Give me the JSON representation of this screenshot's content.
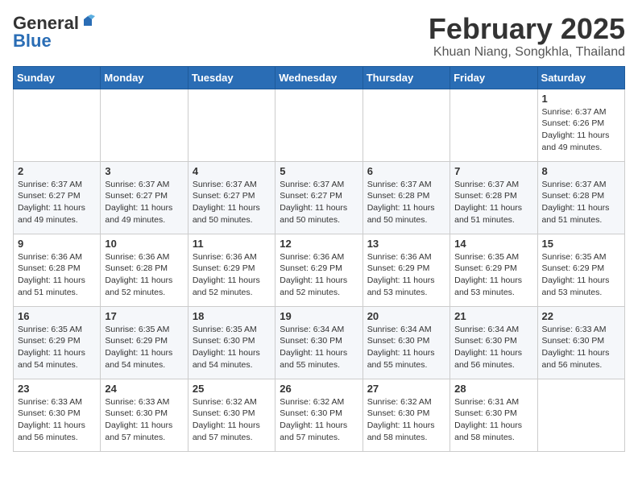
{
  "header": {
    "logo_general": "General",
    "logo_blue": "Blue",
    "month_title": "February 2025",
    "location": "Khuan Niang, Songkhla, Thailand"
  },
  "weekdays": [
    "Sunday",
    "Monday",
    "Tuesday",
    "Wednesday",
    "Thursday",
    "Friday",
    "Saturday"
  ],
  "weeks": [
    [
      {
        "day": "",
        "info": ""
      },
      {
        "day": "",
        "info": ""
      },
      {
        "day": "",
        "info": ""
      },
      {
        "day": "",
        "info": ""
      },
      {
        "day": "",
        "info": ""
      },
      {
        "day": "",
        "info": ""
      },
      {
        "day": "1",
        "info": "Sunrise: 6:37 AM\nSunset: 6:26 PM\nDaylight: 11 hours\nand 49 minutes."
      }
    ],
    [
      {
        "day": "2",
        "info": "Sunrise: 6:37 AM\nSunset: 6:27 PM\nDaylight: 11 hours\nand 49 minutes."
      },
      {
        "day": "3",
        "info": "Sunrise: 6:37 AM\nSunset: 6:27 PM\nDaylight: 11 hours\nand 49 minutes."
      },
      {
        "day": "4",
        "info": "Sunrise: 6:37 AM\nSunset: 6:27 PM\nDaylight: 11 hours\nand 50 minutes."
      },
      {
        "day": "5",
        "info": "Sunrise: 6:37 AM\nSunset: 6:27 PM\nDaylight: 11 hours\nand 50 minutes."
      },
      {
        "day": "6",
        "info": "Sunrise: 6:37 AM\nSunset: 6:28 PM\nDaylight: 11 hours\nand 50 minutes."
      },
      {
        "day": "7",
        "info": "Sunrise: 6:37 AM\nSunset: 6:28 PM\nDaylight: 11 hours\nand 51 minutes."
      },
      {
        "day": "8",
        "info": "Sunrise: 6:37 AM\nSunset: 6:28 PM\nDaylight: 11 hours\nand 51 minutes."
      }
    ],
    [
      {
        "day": "9",
        "info": "Sunrise: 6:36 AM\nSunset: 6:28 PM\nDaylight: 11 hours\nand 51 minutes."
      },
      {
        "day": "10",
        "info": "Sunrise: 6:36 AM\nSunset: 6:28 PM\nDaylight: 11 hours\nand 52 minutes."
      },
      {
        "day": "11",
        "info": "Sunrise: 6:36 AM\nSunset: 6:29 PM\nDaylight: 11 hours\nand 52 minutes."
      },
      {
        "day": "12",
        "info": "Sunrise: 6:36 AM\nSunset: 6:29 PM\nDaylight: 11 hours\nand 52 minutes."
      },
      {
        "day": "13",
        "info": "Sunrise: 6:36 AM\nSunset: 6:29 PM\nDaylight: 11 hours\nand 53 minutes."
      },
      {
        "day": "14",
        "info": "Sunrise: 6:35 AM\nSunset: 6:29 PM\nDaylight: 11 hours\nand 53 minutes."
      },
      {
        "day": "15",
        "info": "Sunrise: 6:35 AM\nSunset: 6:29 PM\nDaylight: 11 hours\nand 53 minutes."
      }
    ],
    [
      {
        "day": "16",
        "info": "Sunrise: 6:35 AM\nSunset: 6:29 PM\nDaylight: 11 hours\nand 54 minutes."
      },
      {
        "day": "17",
        "info": "Sunrise: 6:35 AM\nSunset: 6:29 PM\nDaylight: 11 hours\nand 54 minutes."
      },
      {
        "day": "18",
        "info": "Sunrise: 6:35 AM\nSunset: 6:30 PM\nDaylight: 11 hours\nand 54 minutes."
      },
      {
        "day": "19",
        "info": "Sunrise: 6:34 AM\nSunset: 6:30 PM\nDaylight: 11 hours\nand 55 minutes."
      },
      {
        "day": "20",
        "info": "Sunrise: 6:34 AM\nSunset: 6:30 PM\nDaylight: 11 hours\nand 55 minutes."
      },
      {
        "day": "21",
        "info": "Sunrise: 6:34 AM\nSunset: 6:30 PM\nDaylight: 11 hours\nand 56 minutes."
      },
      {
        "day": "22",
        "info": "Sunrise: 6:33 AM\nSunset: 6:30 PM\nDaylight: 11 hours\nand 56 minutes."
      }
    ],
    [
      {
        "day": "23",
        "info": "Sunrise: 6:33 AM\nSunset: 6:30 PM\nDaylight: 11 hours\nand 56 minutes."
      },
      {
        "day": "24",
        "info": "Sunrise: 6:33 AM\nSunset: 6:30 PM\nDaylight: 11 hours\nand 57 minutes."
      },
      {
        "day": "25",
        "info": "Sunrise: 6:32 AM\nSunset: 6:30 PM\nDaylight: 11 hours\nand 57 minutes."
      },
      {
        "day": "26",
        "info": "Sunrise: 6:32 AM\nSunset: 6:30 PM\nDaylight: 11 hours\nand 57 minutes."
      },
      {
        "day": "27",
        "info": "Sunrise: 6:32 AM\nSunset: 6:30 PM\nDaylight: 11 hours\nand 58 minutes."
      },
      {
        "day": "28",
        "info": "Sunrise: 6:31 AM\nSunset: 6:30 PM\nDaylight: 11 hours\nand 58 minutes."
      },
      {
        "day": "",
        "info": ""
      }
    ]
  ]
}
